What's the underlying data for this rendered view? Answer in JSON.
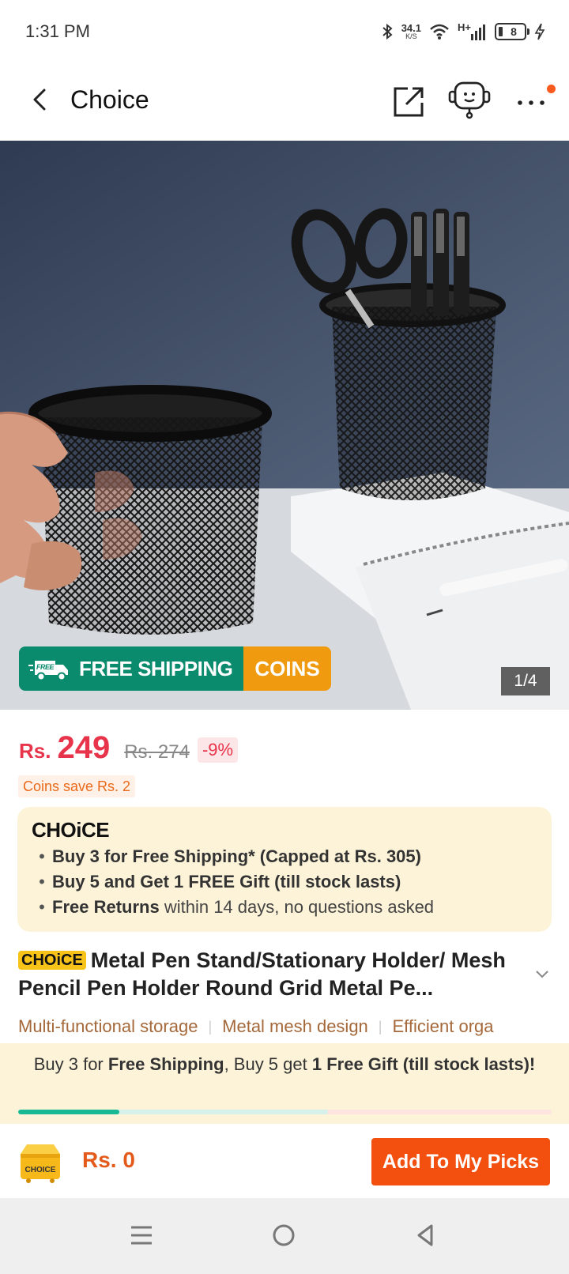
{
  "status_bar": {
    "time": "1:31 PM",
    "speed_value": "34.1",
    "speed_unit": "K/S",
    "network": "H+",
    "battery": "8"
  },
  "header": {
    "title": "Choice"
  },
  "gallery": {
    "badge_free": "FREE",
    "free_shipping": "FREE SHIPPING",
    "coins": "COINS",
    "counter": "1/4"
  },
  "price": {
    "currency": "Rs.",
    "current": "249",
    "original": "Rs. 274",
    "discount": "-9%",
    "coins_save": "Coins save Rs. 2"
  },
  "choice_box": {
    "logo": "CHOiCE",
    "benefits": [
      {
        "bold": "Buy 3 for  Free Shipping* (Capped at Rs. 305)",
        "normal": ""
      },
      {
        "bold": "Buy 5 and Get 1 FREE Gift (till stock lasts)",
        "normal": ""
      },
      {
        "bold": "Free Returns",
        "normal": " within 14 days, no questions asked"
      }
    ]
  },
  "product": {
    "tag": "CHOiCE",
    "title": "Metal Pen Stand/Stationary Holder/ Mesh Pencil Pen Holder Round Grid Metal Pe...",
    "features": [
      "Multi-functional storage",
      "Metal mesh design",
      "Efficient orga"
    ]
  },
  "promo": {
    "part1": "Buy 3 for ",
    "bold1": "Free Shipping",
    "part2": ", Buy 5 get ",
    "bold2": "1 Free Gift (till stock lasts)!",
    "progress": 0.19
  },
  "bottom_bar": {
    "cart_label": "CHOICE",
    "total": "Rs. 0",
    "add_button": "Add To My Picks"
  },
  "colors": {
    "price_red": "#e8344a",
    "brand_orange": "#f34f0e",
    "shipping_green": "#0a8b6d",
    "coins_orange": "#f09a0f",
    "choice_yellow": "#f7c318",
    "promo_bg": "#fdf3d8"
  },
  "icons": [
    "back-arrow-icon",
    "share-icon",
    "customer-service-icon",
    "more-icon",
    "truck-icon",
    "chevron-down-icon",
    "cart-box-icon",
    "menu-icon",
    "home-icon",
    "back-nav-icon"
  ]
}
